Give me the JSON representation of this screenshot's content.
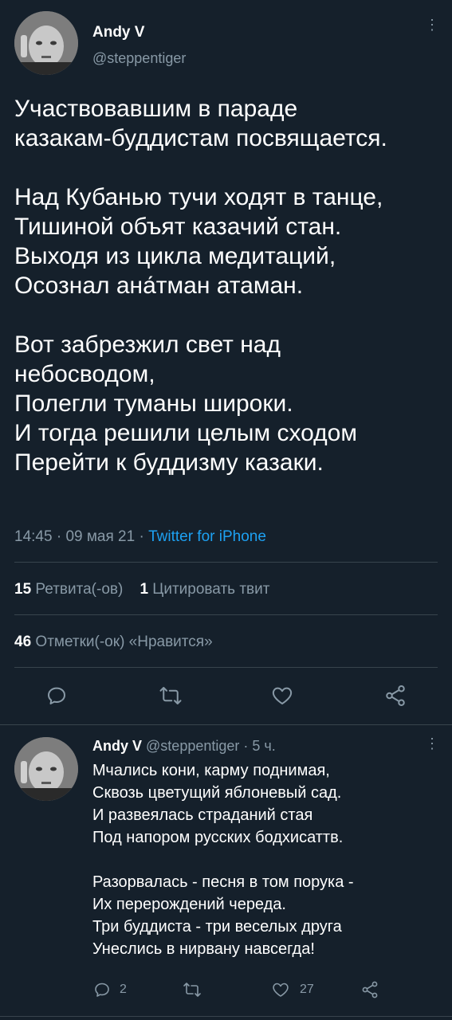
{
  "tweet": {
    "author_name": "Andy V",
    "author_handle": "@steppentiger",
    "text": "Участвовавшим в параде\nказакам-буддистам посвящается.\n\nНад Кубанью тучи ходят в танце,\nТишиной объят казачий стан.\nВыходя из цикла медитаций,\nОсознал ана́тман атаман.\n\nВот забрезжил свет над\nнебосводом,\nПолегли туманы широки.\nИ тогда решили целым сходом\nПерейти к буддизму казаки.",
    "time": "14:45",
    "date": "09 мая 21",
    "sep": "·",
    "source": "Twitter for iPhone",
    "retweets_count": "15",
    "retweets_label": "Ретвита(-ов)",
    "quotes_count": "1",
    "quotes_label": "Цитировать твит",
    "likes_count": "46",
    "likes_label": "Отметки(-ок) «Нравится»",
    "actions": [
      "reply-icon",
      "retweet-icon",
      "like-icon",
      "share-icon"
    ]
  },
  "reply": {
    "author_name": "Andy V",
    "author_handle": "@steppentiger",
    "age": "· 5 ч.",
    "text": "Мчались кони, карму поднимая,\nСквозь цветущий яблоневый сад.\nИ развеялась страданий стая\nПод напором русских бодхисаттв.\n\nРазорвалась - песня в том порука -\nИх перерождений череда.\nТри буддиста - три веселых друга\nУнеслись в нирвану навсегда!",
    "reply_count": "2",
    "like_count": "27"
  },
  "colors": {
    "background": "#15202b",
    "secondary_text": "#8899a6",
    "link": "#1da1f2",
    "divider": "#38444d"
  }
}
